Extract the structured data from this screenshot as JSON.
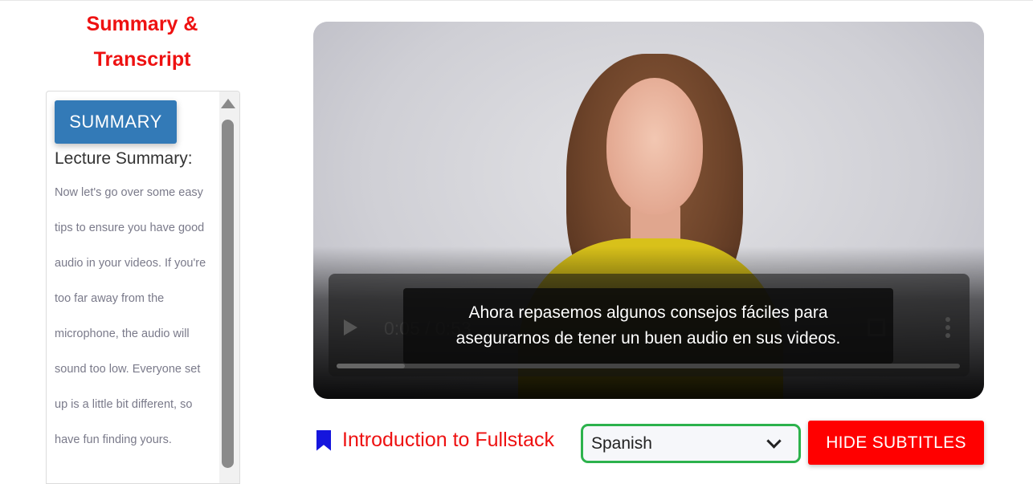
{
  "sidebar": {
    "title_line1": "Summary &",
    "title_line2": "Transcript",
    "summary_button": "SUMMARY",
    "lecture_heading": "Lecture Summary:",
    "lecture_text": "Now let's go over some easy tips to ensure you have good audio in your videos. If you're too far away from the microphone, the audio will sound too low. Everyone set up is a little bit different, so have fun finding yours."
  },
  "video": {
    "time_display": "0:05 / 0:53",
    "progress": 0.11,
    "subtitle_line1": "Ahora repasemos algunos consejos fáciles para",
    "subtitle_line2": "asegurarnos de tener un buen audio en sus videos."
  },
  "footer": {
    "course_title": "Introduction to Fullstack",
    "language_selected": "Spanish",
    "hide_subtitles_button": "HIDE SUBTITLES"
  },
  "colors": {
    "title_red": "#ee1111",
    "summary_button_blue": "#337ab7",
    "select_border_green": "#2cb24c",
    "hide_button_red": "#ff0000",
    "bookmark_blue": "#1515dd"
  }
}
